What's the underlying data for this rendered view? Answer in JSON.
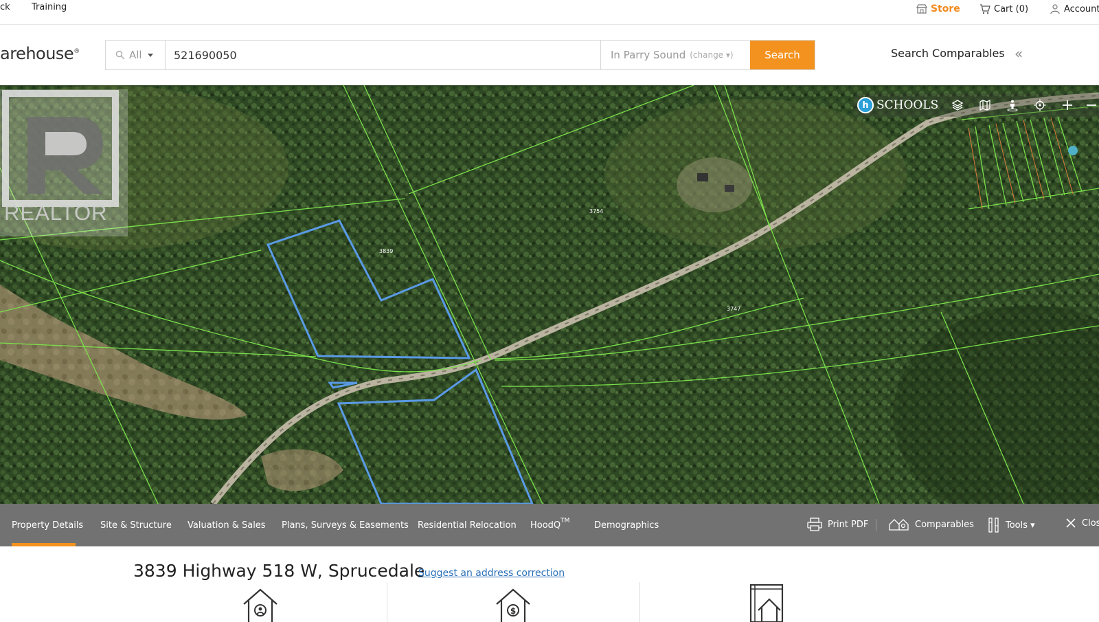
{
  "topnav": {
    "partial_link": "ck",
    "training": "Training",
    "store": "Store",
    "cart": "Cart (0)",
    "account": "Account"
  },
  "logo": {
    "text": "arehouse",
    "trademark": "®",
    "watermark": "REALTOR"
  },
  "search": {
    "scope": "All",
    "query": "521690050",
    "location": "In Parry Sound",
    "change": "(change ▾)",
    "button": "Search",
    "comparables": "Search Comparables"
  },
  "map": {
    "schools_label": "SCHOOLS",
    "schools_badge": "h",
    "lot_labels": [
      "3839",
      "3754",
      "3747"
    ],
    "controls": [
      "layers-icon",
      "map-icon",
      "street-view-icon",
      "locate-icon",
      "zoom-in-icon",
      "zoom-out-icon"
    ]
  },
  "tabs": [
    {
      "label": "Property Details",
      "active": true
    },
    {
      "label": "Site & Structure"
    },
    {
      "label": "Valuation & Sales"
    },
    {
      "label": "Plans, Surveys & Easements"
    },
    {
      "label": "Residential Relocation"
    },
    {
      "label": "HoodQ"
    },
    {
      "label": "Demographics"
    }
  ],
  "hoodq_tm": "TM",
  "tools": {
    "print": "Print PDF",
    "comparables": "Comparables",
    "tools": "Tools ▾",
    "close": "Clos"
  },
  "property": {
    "address": "3839 Highway 518 W, Sprucedale",
    "suggest": "Suggest an address correction"
  },
  "colors": {
    "accent": "#f4921f",
    "tabbar": "#727272",
    "parcel_line": "#7be04a",
    "selected_parcel": "#5a9ae6"
  }
}
